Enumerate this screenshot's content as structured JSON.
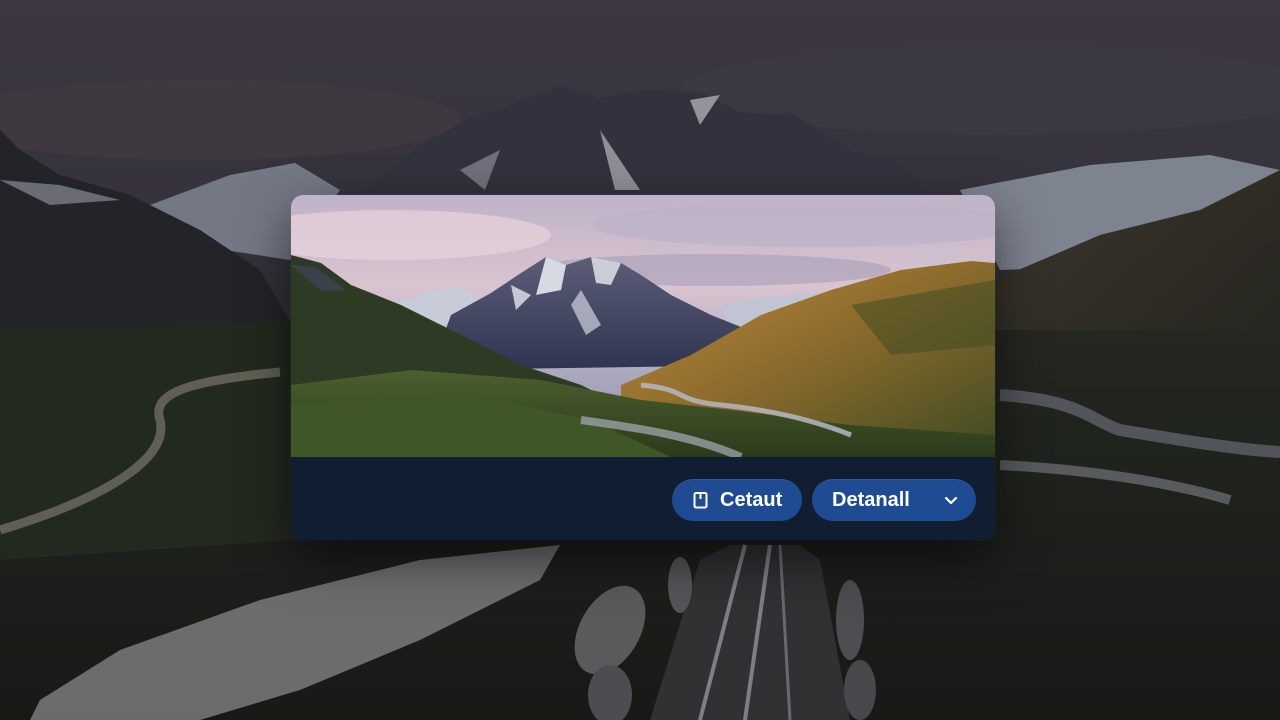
{
  "dialog": {
    "preview_image": "mountain-valley-landscape",
    "buttons": {
      "default_label": "Cetaut",
      "default_icon": "document-icon",
      "details_label": "Detanall",
      "details_icon": "chevron-down-icon"
    },
    "colors": {
      "button_bg": "#1f4b92",
      "bar_bg": "#111d31"
    }
  },
  "background": {
    "image": "mountain-railway-wallpaper"
  }
}
